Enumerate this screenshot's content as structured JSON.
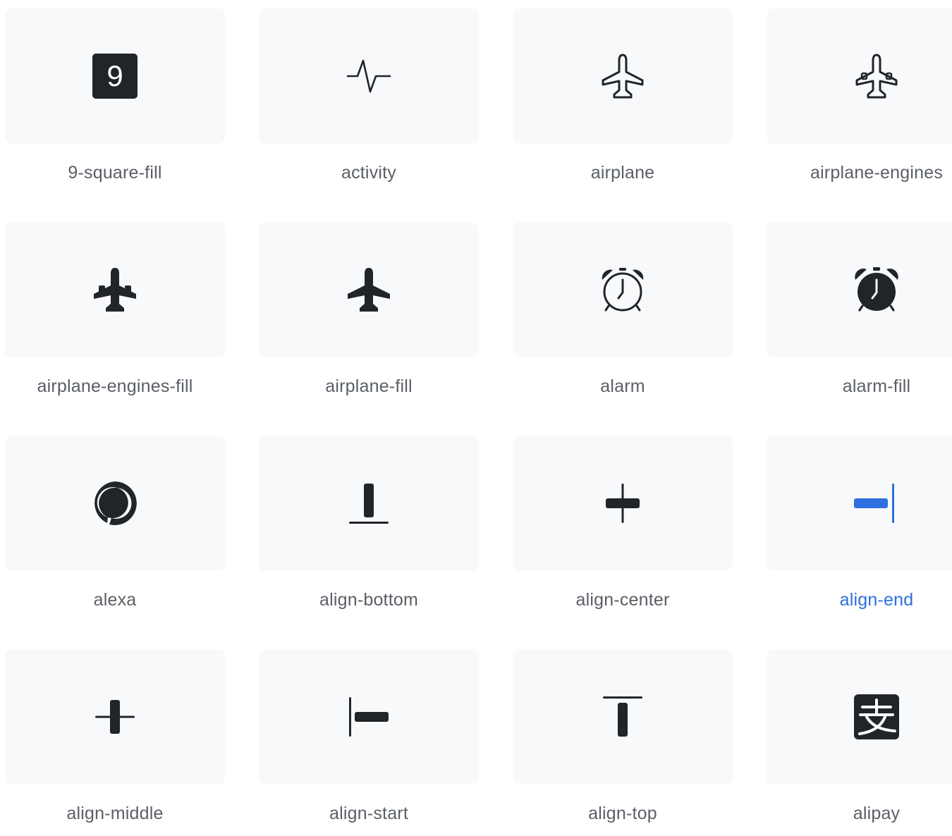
{
  "colors": {
    "tile_background": "#f8f9fa",
    "icon": "#212529",
    "label": "#5a5f66",
    "active_accent": "#2f6fdf"
  },
  "icons": [
    {
      "label": "9-square-fill",
      "icon": "9-square-fill-icon"
    },
    {
      "label": "activity",
      "icon": "activity-icon"
    },
    {
      "label": "airplane",
      "icon": "airplane-icon"
    },
    {
      "label": "airplane-engines",
      "icon": "airplane-engines-icon"
    },
    {
      "label": "airplane-engines-fill",
      "icon": "airplane-engines-fill-icon"
    },
    {
      "label": "airplane-fill",
      "icon": "airplane-fill-icon"
    },
    {
      "label": "alarm",
      "icon": "alarm-icon"
    },
    {
      "label": "alarm-fill",
      "icon": "alarm-fill-icon"
    },
    {
      "label": "alexa",
      "icon": "alexa-icon"
    },
    {
      "label": "align-bottom",
      "icon": "align-bottom-icon"
    },
    {
      "label": "align-center",
      "icon": "align-center-icon"
    },
    {
      "label": "align-end",
      "icon": "align-end-icon",
      "active": true
    },
    {
      "label": "align-middle",
      "icon": "align-middle-icon"
    },
    {
      "label": "align-start",
      "icon": "align-start-icon"
    },
    {
      "label": "align-top",
      "icon": "align-top-icon"
    },
    {
      "label": "alipay",
      "icon": "alipay-icon"
    }
  ]
}
